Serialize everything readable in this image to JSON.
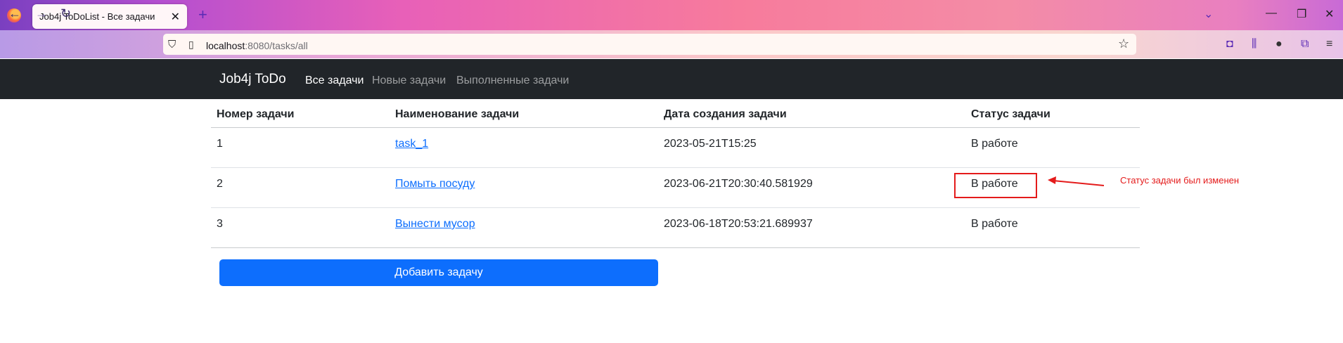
{
  "browser": {
    "tab_title": "Job4j ToDoList - Все задачи",
    "url_host": "localhost",
    "url_rest": ":8080/tasks/all"
  },
  "app": {
    "brand": "Job4j ToDo",
    "nav": [
      {
        "label": "Все задачи"
      },
      {
        "label": "Новые задачи"
      },
      {
        "label": "Выполненные задачи"
      }
    ]
  },
  "table": {
    "headers": [
      "Номер задачи",
      "Наименование задачи",
      "Дата создания задачи",
      "Статус задачи"
    ],
    "rows": [
      {
        "id": "1",
        "name": "task_1",
        "created": "2023-05-21T15:25",
        "status": "В работе"
      },
      {
        "id": "2",
        "name": "Помыть посуду",
        "created": "2023-06-21T20:30:40.581929",
        "status": "В работе"
      },
      {
        "id": "3",
        "name": "Вынести мусор",
        "created": "2023-06-18T20:53:21.689937",
        "status": "В работе"
      }
    ]
  },
  "actions": {
    "add_task": "Добавить задачу"
  },
  "annotation": {
    "text": "Статус задачи был изменен",
    "color": "#e41b1b"
  }
}
